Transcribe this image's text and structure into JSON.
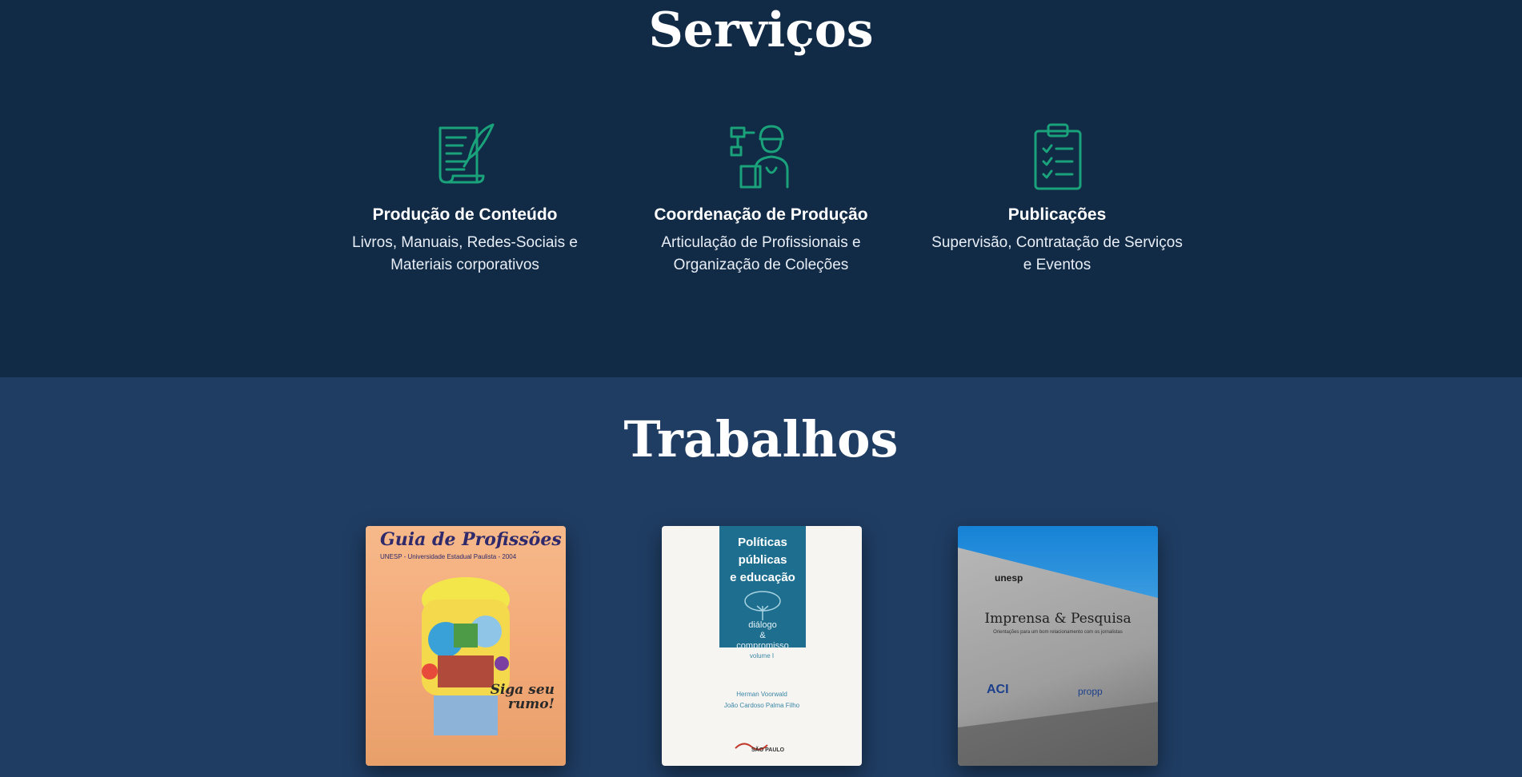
{
  "servicos": {
    "title": "Serviços",
    "items": [
      {
        "icon": "quill-scroll-icon",
        "title": "Produção de Conteúdo",
        "desc_line1": "Livros, Manuais, Redes-Sociais e",
        "desc_line2": "Materiais corporativos"
      },
      {
        "icon": "production-manager-icon",
        "title": "Coordenação de Produção",
        "desc_line1": "Articulação de Profissionais e",
        "desc_line2": "Organização de Coleções"
      },
      {
        "icon": "clipboard-checklist-icon",
        "title": "Publicações",
        "desc_line1": "Supervisão, Contratação de Serviços",
        "desc_line2": "e Eventos"
      }
    ]
  },
  "trabalhos": {
    "title": "Trabalhos",
    "books": [
      {
        "title": "Guia de Profissões",
        "subtitle": "UNESP - Universidade Estadual Paulista - 2004",
        "slogan_line1": "Siga seu",
        "slogan_line2": "rumo!"
      },
      {
        "title_line1": "Políticas",
        "title_line2": "públicas",
        "title_line3": "e educação",
        "subtitle_line1": "diálogo",
        "subtitle_line2": "&",
        "subtitle_line3": "compromisso",
        "volume": "volume I",
        "author1": "Herman Voorwald",
        "author2": "João Cardoso Palma Filho",
        "publisher": "SÃO PAULO"
      },
      {
        "brand": "unesp",
        "title": "Imprensa & Pesquisa",
        "subtitle": "Orientações para um bom relacionamento com os jornalistas",
        "logo1": "ACI",
        "logo2": "propp"
      }
    ]
  },
  "colors": {
    "servicos_bg": "#112a46",
    "trabalhos_bg": "#1f3d63",
    "icon_accent": "#1aa37a"
  }
}
